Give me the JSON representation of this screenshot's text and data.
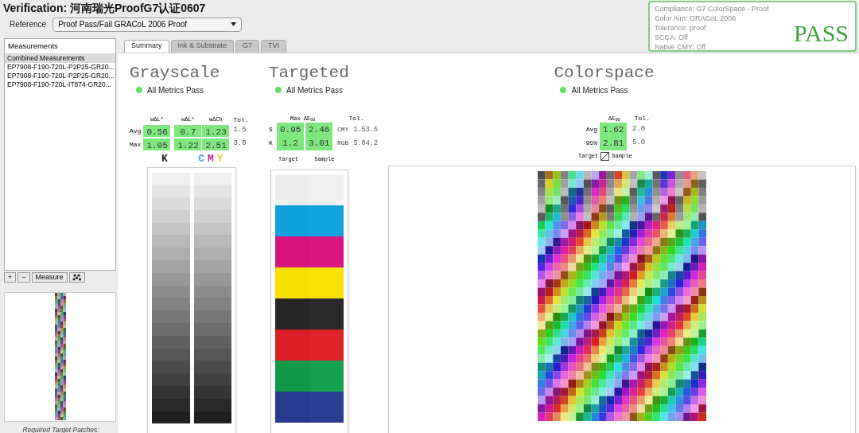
{
  "window": {
    "title": "Verification: 河南瑞光ProofG7认证0607"
  },
  "reference": {
    "label": "Reference",
    "value": "Proof Pass/Fail GRACoL 2006 Proof"
  },
  "status_box": {
    "lines": [
      "Compliance: G7 ColorSpace - Proof",
      "Color Aim: GRACoL 2006",
      "Tolerance: proof",
      "SCCA: Off",
      "Native CMY: Off"
    ],
    "result": "PASS",
    "pass": true
  },
  "sidebar": {
    "header": "Measurements",
    "items": [
      {
        "label": "Combined Measurements",
        "selected": true
      },
      {
        "label": "EP7908-F190-720L-P2P25-GR20...",
        "selected": false
      },
      {
        "label": "EP7908-F190-720L-P2P25-GR20...",
        "selected": false
      },
      {
        "label": "EP7908-F190-720L-IT874-GR20...",
        "selected": false
      }
    ],
    "buttons": [
      "+",
      "−",
      "Measure"
    ],
    "caption": "Required Target Patches:"
  },
  "tabs": [
    {
      "label": "Summary",
      "selected": true
    },
    {
      "label": "Ink & Substrate",
      "selected": false
    },
    {
      "label": "G7",
      "selected": false
    },
    {
      "label": "TVI",
      "selected": false
    }
  ],
  "grayscale": {
    "title": "Grayscale",
    "status": "All Metrics Pass",
    "pass": true,
    "tol_header": "Tol.",
    "groups": [
      {
        "headers": [
          "wΔL*"
        ]
      },
      {
        "headers": [
          "wΔL*",
          "wΔCh"
        ]
      }
    ],
    "rows": [
      {
        "label": "Avg",
        "groups": [
          [
            {
              "text": "0.56",
              "pass": true
            }
          ],
          [
            {
              "text": "0.7",
              "pass": true
            },
            {
              "text": "1.23",
              "pass": true
            }
          ]
        ],
        "tol": "1.5"
      },
      {
        "label": "Max",
        "groups": [
          [
            {
              "text": "1.05",
              "pass": true
            }
          ],
          [
            {
              "text": "1.22",
              "pass": true
            },
            {
              "text": "2.51",
              "pass": true
            }
          ]
        ],
        "tol": "3.0"
      }
    ],
    "channels": [
      [
        {
          "label": "K",
          "color": "#222222"
        }
      ],
      [
        {
          "label": "C",
          "color": "#3aa0e0"
        },
        {
          "label": "M",
          "color": "#d0208a"
        },
        {
          "label": "Y",
          "color": "#e8d020"
        }
      ]
    ]
  },
  "targeted": {
    "title": "Targeted",
    "status": "All Metrics Pass",
    "pass": true,
    "header": "Max ΔE$_{00}$",
    "tol_header": "Tol.",
    "rows": [
      {
        "label": "S",
        "values": [
          {
            "text": "0.95",
            "pass": true
          },
          {
            "text": "2.46",
            "pass": true
          }
        ],
        "space": "CMY",
        "tol": [
          "1.5",
          "3.5"
        ]
      },
      {
        "label": "K",
        "values": [
          {
            "text": "1.2",
            "pass": true
          },
          {
            "text": "3.01",
            "pass": true
          }
        ],
        "space": "RGB",
        "tol": [
          "5.0",
          "4.2"
        ]
      }
    ],
    "legend": [
      "Target",
      "Sample"
    ],
    "patches": [
      [
        {
          "color": "#eeeeee"
        },
        {
          "color": "#f0f0f0"
        }
      ],
      [
        {
          "color": "#10a0dc"
        },
        {
          "color": "#12a2de"
        }
      ],
      [
        {
          "color": "#d8127e"
        },
        {
          "color": "#da1682"
        }
      ],
      [
        {
          "color": "#f5e000"
        },
        {
          "color": "#f7e204"
        }
      ],
      [
        {
          "color": "#262626"
        },
        {
          "color": "#2a2a2a"
        }
      ],
      [
        {
          "color": "#dc1f26"
        },
        {
          "color": "#e0242a"
        }
      ],
      [
        {
          "color": "#129a48"
        },
        {
          "color": "#14a04c"
        }
      ],
      [
        {
          "color": "#263a8e"
        },
        {
          "color": "#2a3e94"
        }
      ]
    ]
  },
  "colorspace": {
    "title": "Colorspace",
    "status": "All Metrics Pass",
    "pass": true,
    "header": "ΔE$_{00}$",
    "tol_header": "Tol.",
    "rows": [
      {
        "label": "Avg",
        "value": {
          "text": "1.62",
          "pass": true
        },
        "tol": "2.0"
      },
      {
        "label": "95%",
        "value": {
          "text": "2.81",
          "pass": true
        },
        "tol": "5.0"
      }
    ],
    "legend": [
      "Target",
      "Sample"
    ]
  }
}
